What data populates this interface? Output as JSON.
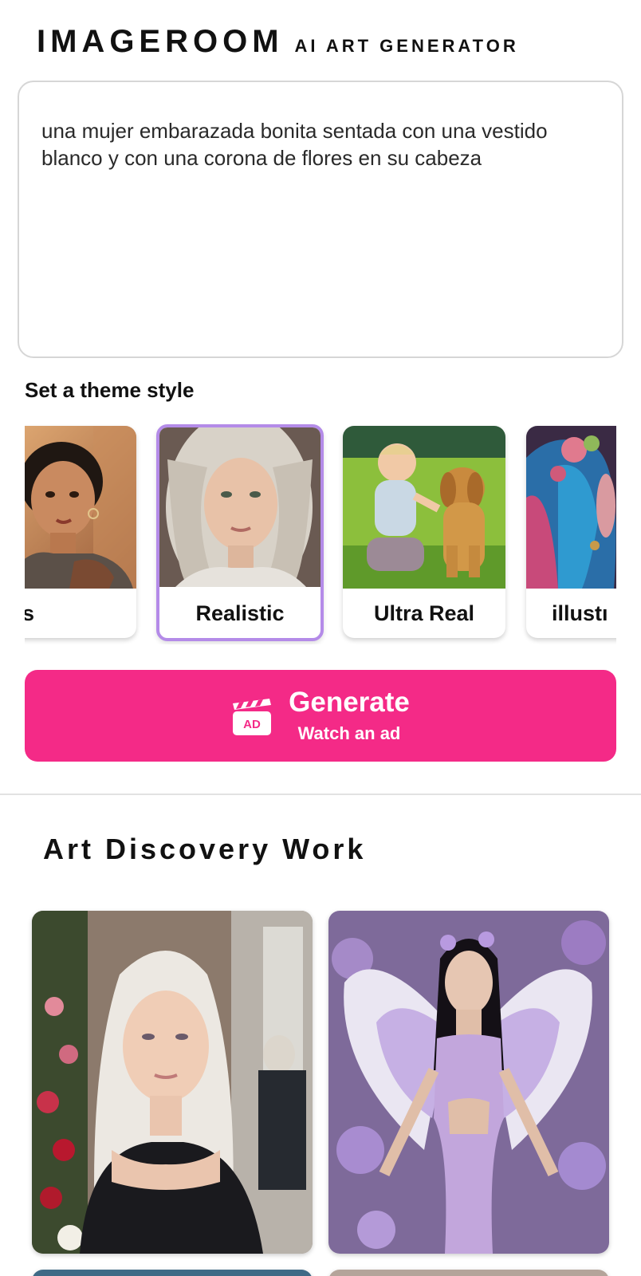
{
  "header": {
    "brand": "IMAGEROOM",
    "subtitle": "AI ART GENERATOR"
  },
  "prompt": {
    "value": "una mujer embarazada bonita sentada con una vestido blanco y con una corona de flores en su cabeza"
  },
  "theme": {
    "label": "Set a theme style",
    "selected": "Realistic",
    "styles": [
      {
        "label": "Tatos"
      },
      {
        "label": "Realistic"
      },
      {
        "label": "Ultra Real"
      },
      {
        "label": "illustı"
      }
    ]
  },
  "generate": {
    "label": "Generate",
    "sublabel": "Watch an ad",
    "ad_badge": "AD",
    "color": "#f42a87"
  },
  "discovery": {
    "title": "Art Discovery Work"
  },
  "colors": {
    "accent": "#f42a87",
    "selected_border": "#b48be8"
  }
}
